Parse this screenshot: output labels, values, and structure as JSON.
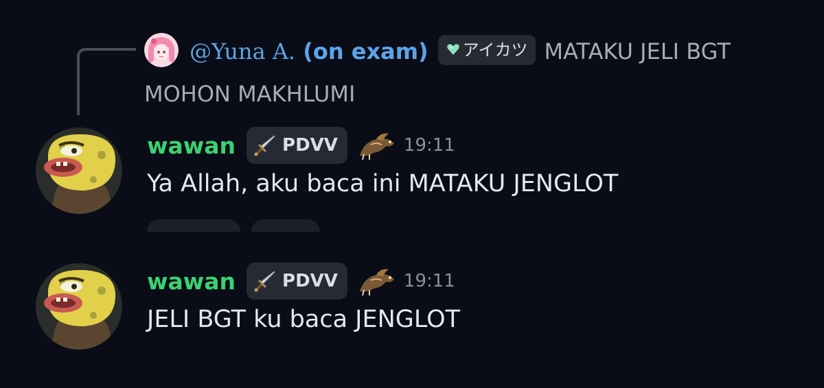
{
  "reply": {
    "mention": "@Yuna A.",
    "mention_suffix": " (on exam)",
    "tag_label": "アイカツ",
    "text_line1": "MATAKU JELI BGT",
    "text_line2": "MOHON MAKHLUMI",
    "avatar_icon": "pink-hair-anime-avatar-icon",
    "tag_icon": "heart-gem-icon"
  },
  "messages": [
    {
      "username": "wawan",
      "role": "PDVV",
      "role_icon": "sword-icon",
      "deco_icon": "dragon-decoration-icon",
      "time": "19:11",
      "text": "Ya Allah, aku baca ini MATAKU JENGLOT",
      "avatar_icon": "spongebob-caveman-avatar-icon"
    },
    {
      "username": "wawan",
      "role": "PDVV",
      "role_icon": "sword-icon",
      "deco_icon": "dragon-decoration-icon",
      "time": "19:11",
      "text": "JELI BGT ku baca JENGLOT",
      "avatar_icon": "spongebob-caveman-avatar-icon"
    }
  ],
  "colors": {
    "background": "#0a0d17",
    "username": "#3bd16f",
    "mention": "#5fa3e8",
    "pill_bg": "#262a34",
    "muted_text": "#a9acb5"
  }
}
